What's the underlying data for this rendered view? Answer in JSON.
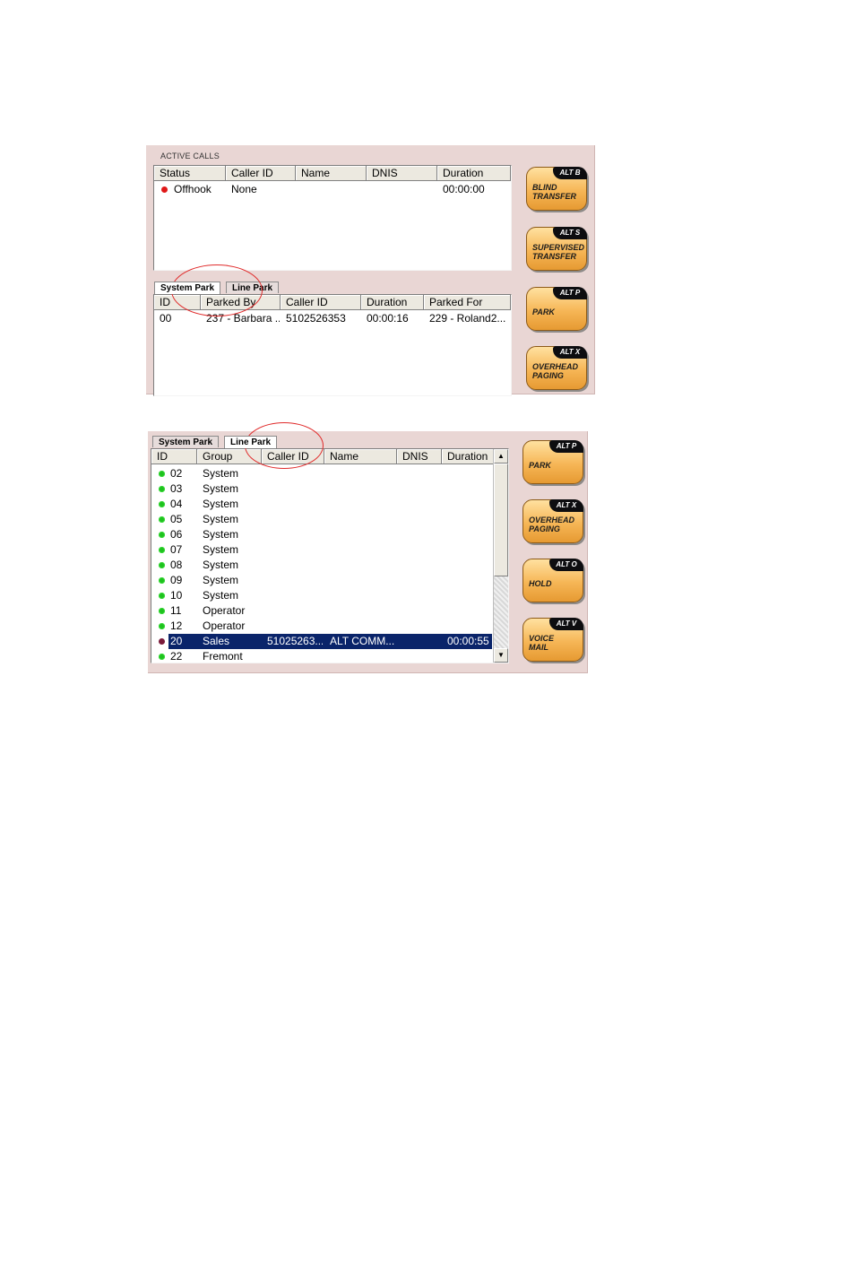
{
  "panel1": {
    "section_label": "ACTIVE CALLS",
    "active_calls": {
      "columns": [
        "Status",
        "Caller ID",
        "Name",
        "DNIS",
        "Duration"
      ],
      "rows": [
        {
          "status": "Offhook",
          "caller_id": "None",
          "name": "",
          "dnis": "",
          "duration": "00:00:00",
          "status_color": "#e01818"
        }
      ]
    },
    "tabs": [
      "System Park",
      "Line Park"
    ],
    "park": {
      "columns": [
        "ID",
        "Parked By",
        "Caller ID",
        "Duration",
        "Parked For"
      ],
      "rows": [
        {
          "id": "00",
          "parked_by": "237 - Barbara ...",
          "caller_id": "5102526353",
          "duration": "00:00:16",
          "parked_for": "229 - Roland2..."
        }
      ]
    },
    "buttons": [
      {
        "alt": "ALT B",
        "label": "BLIND TRANSFER",
        "line1": "BLIND",
        "line2": "TRANSFER"
      },
      {
        "alt": "ALT S",
        "label": "SUPERVISED TRANSFER",
        "line1": "SUPERVISED",
        "line2": "TRANSFER"
      },
      {
        "alt": "ALT P",
        "label": "PARK",
        "line1": "PARK",
        "line2": ""
      },
      {
        "alt": "ALT X",
        "label": "OVERHEAD PAGING",
        "line1": "OVERHEAD",
        "line2": "PAGING"
      }
    ]
  },
  "panel2": {
    "tabs": [
      "System Park",
      "Line Park"
    ],
    "lines": {
      "columns": [
        "ID",
        "Group",
        "Caller ID",
        "Name",
        "DNIS",
        "Duration"
      ],
      "rows": [
        {
          "id": "02",
          "group": "System",
          "caller_id": "",
          "name": "",
          "dnis": "",
          "duration": "",
          "dot": "green"
        },
        {
          "id": "03",
          "group": "System",
          "caller_id": "",
          "name": "",
          "dnis": "",
          "duration": "",
          "dot": "green"
        },
        {
          "id": "04",
          "group": "System",
          "caller_id": "",
          "name": "",
          "dnis": "",
          "duration": "",
          "dot": "green"
        },
        {
          "id": "05",
          "group": "System",
          "caller_id": "",
          "name": "",
          "dnis": "",
          "duration": "",
          "dot": "green"
        },
        {
          "id": "06",
          "group": "System",
          "caller_id": "",
          "name": "",
          "dnis": "",
          "duration": "",
          "dot": "green"
        },
        {
          "id": "07",
          "group": "System",
          "caller_id": "",
          "name": "",
          "dnis": "",
          "duration": "",
          "dot": "green"
        },
        {
          "id": "08",
          "group": "System",
          "caller_id": "",
          "name": "",
          "dnis": "",
          "duration": "",
          "dot": "green"
        },
        {
          "id": "09",
          "group": "System",
          "caller_id": "",
          "name": "",
          "dnis": "",
          "duration": "",
          "dot": "green"
        },
        {
          "id": "10",
          "group": "System",
          "caller_id": "",
          "name": "",
          "dnis": "",
          "duration": "",
          "dot": "green"
        },
        {
          "id": "11",
          "group": "Operator",
          "caller_id": "",
          "name": "",
          "dnis": "",
          "duration": "",
          "dot": "green"
        },
        {
          "id": "12",
          "group": "Operator",
          "caller_id": "",
          "name": "",
          "dnis": "",
          "duration": "",
          "dot": "green"
        },
        {
          "id": "20",
          "group": "Sales",
          "caller_id": "51025263...",
          "name": "ALT COMM...",
          "dnis": "",
          "duration": "00:00:55",
          "dot": "maroon",
          "selected": true
        },
        {
          "id": "22",
          "group": "Fremont",
          "caller_id": "",
          "name": "",
          "dnis": "",
          "duration": "",
          "dot": "green"
        }
      ]
    },
    "buttons": [
      {
        "alt": "ALT P",
        "label": "PARK",
        "line1": "PARK",
        "line2": ""
      },
      {
        "alt": "ALT X",
        "label": "OVERHEAD PAGING",
        "line1": "OVERHEAD",
        "line2": "PAGING"
      },
      {
        "alt": "ALT O",
        "label": "HOLD",
        "line1": "HOLD",
        "line2": ""
      },
      {
        "alt": "ALT V",
        "label": "VOICE MAIL",
        "line1": "VOICE",
        "line2": "MAIL"
      }
    ]
  }
}
